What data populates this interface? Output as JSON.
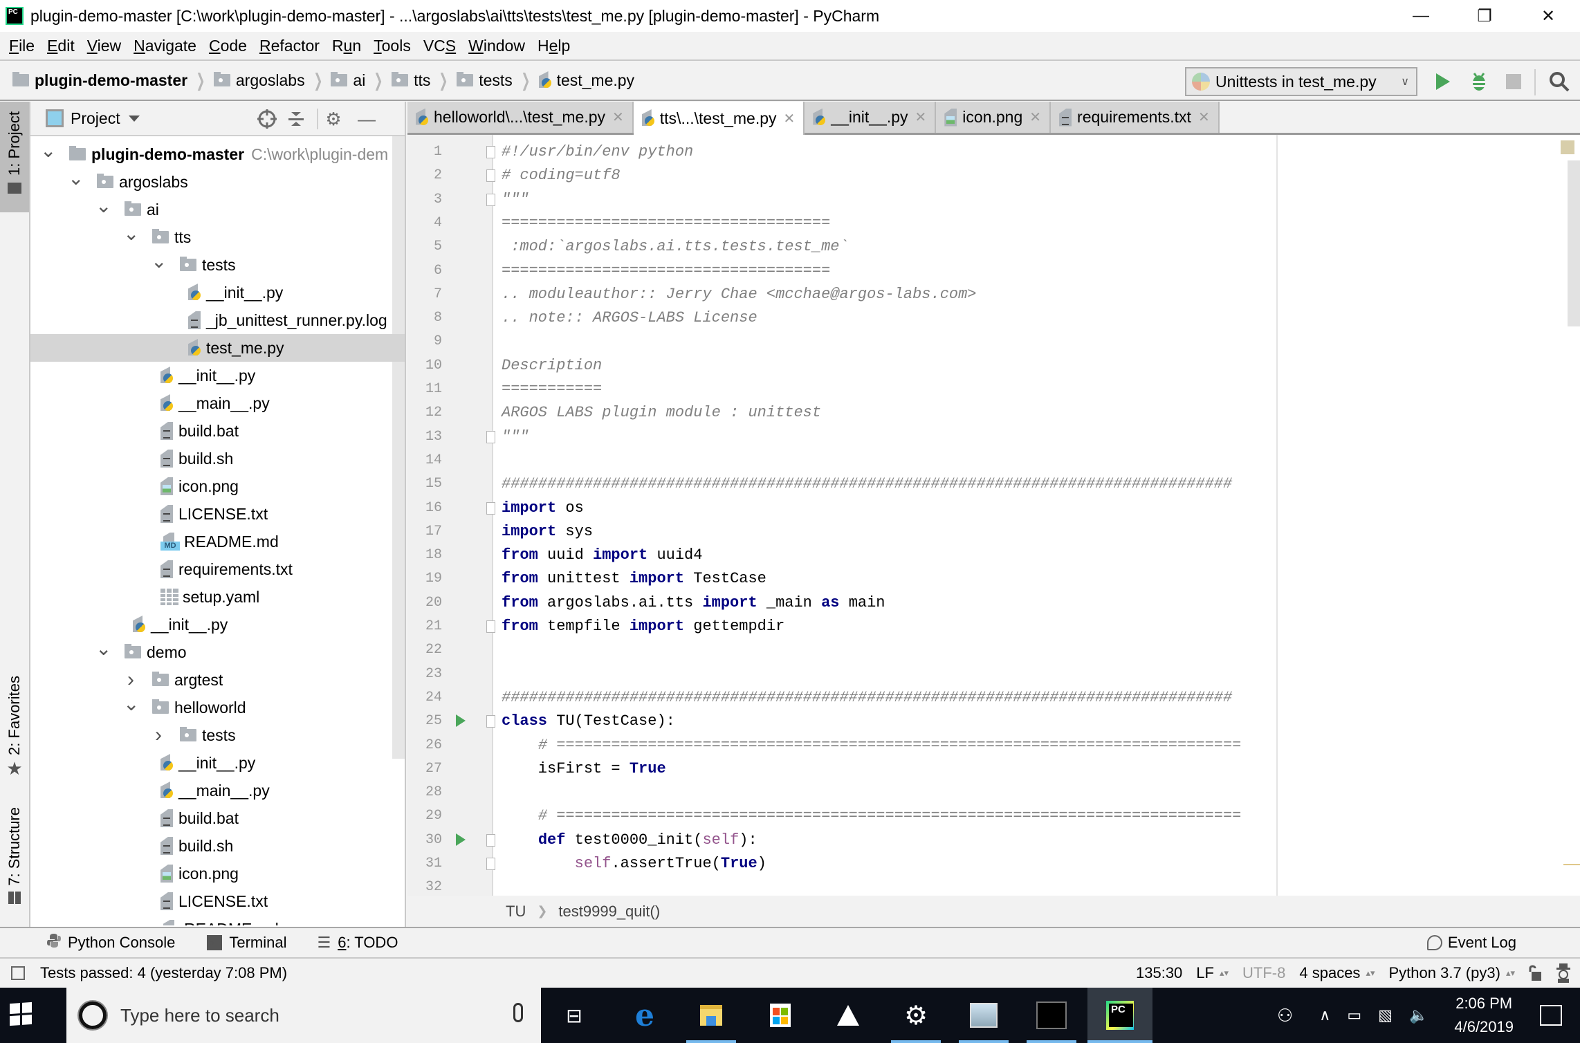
{
  "window": {
    "app_icon": "pycharm-logo",
    "title": "plugin-demo-master [C:\\work\\plugin-demo-master] - ...\\argoslabs\\ai\\tts\\tests\\test_me.py [plugin-demo-master] - PyCharm",
    "controls": {
      "minimize": "—",
      "maximize": "❐",
      "close": "✕"
    }
  },
  "menu": [
    {
      "label": "File",
      "mnemonic": "F",
      "rest": "ile"
    },
    {
      "label": "Edit",
      "mnemonic": "E",
      "rest": "dit"
    },
    {
      "label": "View",
      "mnemonic": "V",
      "rest": "iew"
    },
    {
      "label": "Navigate",
      "mnemonic": "N",
      "rest": "avigate"
    },
    {
      "label": "Code",
      "mnemonic": "C",
      "rest": "ode"
    },
    {
      "label": "Refactor",
      "mnemonic": "R",
      "rest": "efactor"
    },
    {
      "label": "Run",
      "pre": "R",
      "mnemonic": "u",
      "rest": "n"
    },
    {
      "label": "Tools",
      "mnemonic": "T",
      "rest": "ools"
    },
    {
      "label": "VCS",
      "pre": "VC",
      "mnemonic": "S",
      "rest": ""
    },
    {
      "label": "Window",
      "mnemonic": "W",
      "rest": "indow"
    },
    {
      "label": "Help",
      "pre": "H",
      "mnemonic": "e",
      "rest": "lp"
    }
  ],
  "nav_breadcrumb": [
    {
      "label": "plugin-demo-master",
      "icon": "folder-icon"
    },
    {
      "label": "argoslabs",
      "icon": "source-folder-icon"
    },
    {
      "label": "ai",
      "icon": "source-folder-icon"
    },
    {
      "label": "tts",
      "icon": "source-folder-icon"
    },
    {
      "label": "tests",
      "icon": "source-folder-icon"
    },
    {
      "label": "test_me.py",
      "icon": "python-file-icon"
    }
  ],
  "run_toolbar": {
    "config_label": "Unittests in test_me.py",
    "run_icon": "play-icon",
    "debug_icon": "bug-icon",
    "stop_icon": "stop-icon",
    "search_icon": "search-icon"
  },
  "left_strip": {
    "project_tab": "1: Project",
    "favorites_tab": "2: Favorites",
    "structure_tab": "7: Structure"
  },
  "project_panel": {
    "title": "Project",
    "tree": [
      {
        "label": "plugin-demo-master",
        "path": "C:\\work\\plugin-dem",
        "type": "folder",
        "depth": 0,
        "expanded": true,
        "bold": true
      },
      {
        "label": "argoslabs",
        "type": "src-folder",
        "depth": 1,
        "expanded": true
      },
      {
        "label": "ai",
        "type": "src-folder",
        "depth": 2,
        "expanded": true
      },
      {
        "label": "tts",
        "type": "src-folder",
        "depth": 3,
        "expanded": true
      },
      {
        "label": "tests",
        "type": "src-folder",
        "depth": 4,
        "expanded": true
      },
      {
        "label": "__init__.py",
        "type": "py",
        "depth": 5
      },
      {
        "label": "_jb_unittest_runner.py.log",
        "type": "txt",
        "depth": 5
      },
      {
        "label": "test_me.py",
        "type": "py",
        "depth": 5,
        "selected": true
      },
      {
        "label": "__init__.py",
        "type": "py",
        "depth": 4
      },
      {
        "label": "__main__.py",
        "type": "py",
        "depth": 4
      },
      {
        "label": "build.bat",
        "type": "txt",
        "depth": 4
      },
      {
        "label": "build.sh",
        "type": "txt",
        "depth": 4
      },
      {
        "label": "icon.png",
        "type": "img",
        "depth": 4
      },
      {
        "label": "LICENSE.txt",
        "type": "txt",
        "depth": 4
      },
      {
        "label": "README.md",
        "type": "md",
        "depth": 4
      },
      {
        "label": "requirements.txt",
        "type": "txt",
        "depth": 4
      },
      {
        "label": "setup.yaml",
        "type": "yaml",
        "depth": 4
      },
      {
        "label": "__init__.py",
        "type": "py",
        "depth": 3
      },
      {
        "label": "demo",
        "type": "src-folder",
        "depth": 2,
        "expanded": true
      },
      {
        "label": "argtest",
        "type": "src-folder",
        "depth": 3,
        "expanded": false
      },
      {
        "label": "helloworld",
        "type": "src-folder",
        "depth": 3,
        "expanded": true
      },
      {
        "label": "tests",
        "type": "src-folder",
        "depth": 4,
        "expanded": false
      },
      {
        "label": "__init__.py",
        "type": "py",
        "depth": 4
      },
      {
        "label": "__main__.py",
        "type": "py",
        "depth": 4
      },
      {
        "label": "build.bat",
        "type": "txt",
        "depth": 4
      },
      {
        "label": "build.sh",
        "type": "txt",
        "depth": 4
      },
      {
        "label": "icon.png",
        "type": "img",
        "depth": 4
      },
      {
        "label": "LICENSE.txt",
        "type": "txt",
        "depth": 4
      },
      {
        "label": "README.md",
        "type": "md",
        "depth": 4
      }
    ]
  },
  "tabs": [
    {
      "label": "helloworld\\...\\test_me.py",
      "type": "py",
      "active": false
    },
    {
      "label": "tts\\...\\test_me.py",
      "type": "py",
      "active": true
    },
    {
      "label": "__init__.py",
      "type": "py",
      "active": false
    },
    {
      "label": "icon.png",
      "type": "img",
      "active": false
    },
    {
      "label": "requirements.txt",
      "type": "txt",
      "active": false
    }
  ],
  "editor": {
    "lines": [
      {
        "n": "1",
        "fold": true,
        "tokens": [
          [
            "cm",
            "#!/usr/bin/env python"
          ]
        ]
      },
      {
        "n": "2",
        "fold": true,
        "tokens": [
          [
            "cm",
            "# coding=utf8"
          ]
        ]
      },
      {
        "n": "3",
        "fold": true,
        "tokens": [
          [
            "cm",
            "\"\"\""
          ]
        ]
      },
      {
        "n": "4",
        "tokens": [
          [
            "cm",
            "===================================="
          ]
        ]
      },
      {
        "n": "5",
        "tokens": [
          [
            "cm",
            " :mod:`argoslabs.ai.tts.tests.test_me`"
          ]
        ]
      },
      {
        "n": "6",
        "tokens": [
          [
            "cm",
            "===================================="
          ]
        ]
      },
      {
        "n": "7",
        "tokens": [
          [
            "cm",
            ".. moduleauthor:: Jerry Chae <mcchae@argos-labs.com>"
          ]
        ]
      },
      {
        "n": "8",
        "tokens": [
          [
            "cm",
            ".. note:: ARGOS-LABS License"
          ]
        ]
      },
      {
        "n": "9",
        "tokens": []
      },
      {
        "n": "10",
        "tokens": [
          [
            "cm",
            "Description"
          ]
        ]
      },
      {
        "n": "11",
        "tokens": [
          [
            "cm",
            "==========="
          ]
        ]
      },
      {
        "n": "12",
        "tokens": [
          [
            "cm",
            "ARGOS LABS plugin module : unittest"
          ]
        ]
      },
      {
        "n": "13",
        "fold": true,
        "tokens": [
          [
            "cm",
            "\"\"\""
          ]
        ]
      },
      {
        "n": "14",
        "tokens": []
      },
      {
        "n": "15",
        "tokens": [
          [
            "cm",
            "################################################################################"
          ]
        ]
      },
      {
        "n": "16",
        "fold": true,
        "tokens": [
          [
            "kw",
            "import"
          ],
          [
            "",
            " os"
          ]
        ]
      },
      {
        "n": "17",
        "tokens": [
          [
            "kw",
            "import"
          ],
          [
            "",
            " sys"
          ]
        ]
      },
      {
        "n": "18",
        "tokens": [
          [
            "kw",
            "from"
          ],
          [
            "",
            " uuid "
          ],
          [
            "kw",
            "import"
          ],
          [
            "",
            " uuid4"
          ]
        ]
      },
      {
        "n": "19",
        "tokens": [
          [
            "kw",
            "from"
          ],
          [
            "",
            " unittest "
          ],
          [
            "kw",
            "import"
          ],
          [
            "",
            " TestCase"
          ]
        ]
      },
      {
        "n": "20",
        "tokens": [
          [
            "kw",
            "from"
          ],
          [
            "",
            " argoslabs.ai.tts "
          ],
          [
            "kw",
            "import"
          ],
          [
            "",
            " _main "
          ],
          [
            "kw",
            "as"
          ],
          [
            "",
            " main"
          ]
        ]
      },
      {
        "n": "21",
        "fold": true,
        "tokens": [
          [
            "kw",
            "from"
          ],
          [
            "",
            " tempfile "
          ],
          [
            "kw",
            "import"
          ],
          [
            "",
            " gettempdir"
          ]
        ]
      },
      {
        "n": "22",
        "tokens": []
      },
      {
        "n": "23",
        "tokens": []
      },
      {
        "n": "24",
        "tokens": [
          [
            "cm",
            "################################################################################"
          ]
        ]
      },
      {
        "n": "25",
        "fold": true,
        "run": true,
        "tokens": [
          [
            "kw",
            "class"
          ],
          [
            "",
            " TU(TestCase):"
          ]
        ]
      },
      {
        "n": "26",
        "tokens": [
          [
            "",
            "    "
          ],
          [
            "cm",
            "# ==========================================================================="
          ]
        ]
      },
      {
        "n": "27",
        "tokens": [
          [
            "",
            "    isFirst = "
          ],
          [
            "kw",
            "True"
          ]
        ]
      },
      {
        "n": "28",
        "tokens": []
      },
      {
        "n": "29",
        "tokens": [
          [
            "",
            "    "
          ],
          [
            "cm",
            "# ==========================================================================="
          ]
        ]
      },
      {
        "n": "30",
        "fold": true,
        "run": true,
        "tokens": [
          [
            "",
            "    "
          ],
          [
            "kw",
            "def"
          ],
          [
            "",
            " test0000_init("
          ],
          [
            "self",
            "self"
          ],
          [
            "",
            "):"
          ]
        ]
      },
      {
        "n": "31",
        "fold": true,
        "tokens": [
          [
            "",
            "        "
          ],
          [
            "self",
            "self"
          ],
          [
            "",
            ".assertTrue("
          ],
          [
            "kw",
            "True"
          ],
          [
            "",
            ")"
          ]
        ]
      },
      {
        "n": "32",
        "tokens": []
      }
    ]
  },
  "editor_breadcrumb": {
    "class": "TU",
    "method": "test9999_quit()"
  },
  "tool_windows": {
    "python_console": "Python Console",
    "terminal": "Terminal",
    "todo_num": "6",
    "todo": ": TODO",
    "event_log": "Event Log"
  },
  "status": {
    "message": "Tests passed: 4 (yesterday 7:08 PM)",
    "position": "135:30",
    "line_sep": "LF",
    "encoding": "UTF-8",
    "indent": "4 spaces",
    "interpreter": "Python 3.7 (py3)"
  },
  "taskbar": {
    "search_placeholder": "Type here to search",
    "time": "2:06 PM",
    "date": "4/6/2019"
  },
  "colors": {
    "keyword": "#000080",
    "comment": "#808080",
    "self": "#94558d",
    "run_green": "#4aa65a",
    "selection": "#d5d5d5"
  }
}
